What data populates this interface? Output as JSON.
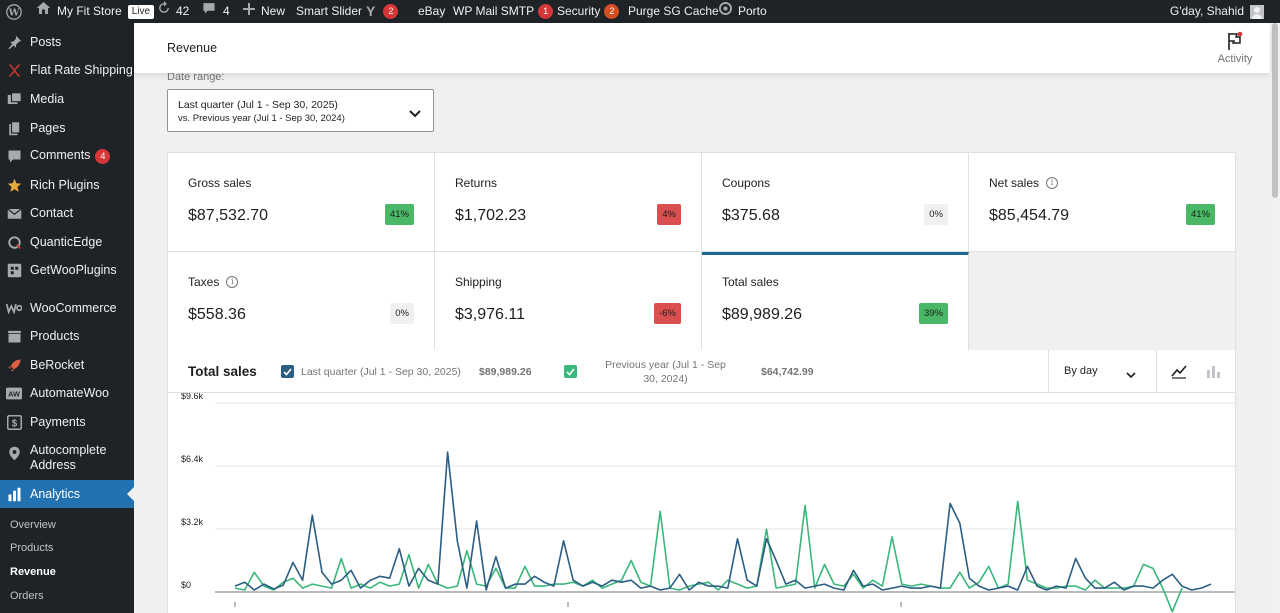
{
  "admin_bar": {
    "site_name": "My Fit Store",
    "live_badge": "Live",
    "updates_count": "42",
    "comments_count": "4",
    "new_label": "New",
    "smart_slider": "Smart Slider",
    "yoast_count": "2",
    "ebay": "eBay",
    "wp_mail_smtp": "WP Mail SMTP",
    "wp_mail_smtp_count": "1",
    "security": "Security",
    "security_count": "2",
    "purge_cache": "Purge SG Cache",
    "theme": "Porto",
    "greeting": "G'day, Shahid"
  },
  "sidebar": {
    "items": [
      {
        "label": "Posts",
        "icon": "pin-icon"
      },
      {
        "label": "Flat Rate Shipping",
        "icon": "shipping-icon"
      },
      {
        "label": "Media",
        "icon": "media-icon"
      },
      {
        "label": "Pages",
        "icon": "pages-icon"
      },
      {
        "label": "Comments",
        "icon": "comments-icon",
        "badge": "4"
      },
      {
        "label": "Rich Plugins",
        "icon": "star-icon"
      },
      {
        "label": "Contact",
        "icon": "mail-icon"
      },
      {
        "label": "QuanticEdge",
        "icon": "quanticedge-icon"
      },
      {
        "label": "GetWooPlugins",
        "icon": "grid-icon"
      },
      {
        "label": "WooCommerce",
        "icon": "woo-icon"
      },
      {
        "label": "Products",
        "icon": "box-icon"
      },
      {
        "label": "BeRocket",
        "icon": "rocket-icon"
      },
      {
        "label": "AutomateWoo",
        "icon": "aw-icon"
      },
      {
        "label": "Payments",
        "icon": "dollar-icon"
      },
      {
        "label": "Autocomplete Address",
        "icon": "location-icon"
      },
      {
        "label": "Analytics",
        "icon": "bar-chart-icon"
      }
    ],
    "sub_items": [
      "Overview",
      "Products",
      "Revenue",
      "Orders"
    ]
  },
  "header": {
    "title": "Revenue",
    "activity_label": "Activity"
  },
  "date_range": {
    "label": "Date range:",
    "main": "Last quarter (Jul 1 - Sep 30, 2025)",
    "compare": "vs. Previous year (Jul 1 - Sep 30, 2024)"
  },
  "summary": [
    {
      "label": "Gross sales",
      "value": "$87,532.70",
      "delta": "41%",
      "trend": "pos"
    },
    {
      "label": "Returns",
      "value": "$1,702.23",
      "delta": "4%",
      "trend": "neg"
    },
    {
      "label": "Coupons",
      "value": "$375.68",
      "delta": "0%",
      "trend": "zero"
    },
    {
      "label": "Net sales",
      "value": "$85,454.79",
      "delta": "41%",
      "trend": "pos",
      "info": true
    },
    {
      "label": "Taxes",
      "value": "$558.36",
      "delta": "0%",
      "trend": "zero",
      "info": true
    },
    {
      "label": "Shipping",
      "value": "$3,976.11",
      "delta": "-6%",
      "trend": "neg"
    },
    {
      "label": "Total sales",
      "value": "$89,989.26",
      "delta": "39%",
      "trend": "pos",
      "selected": true
    }
  ],
  "chart_panel": {
    "title": "Total sales",
    "legend": [
      {
        "label": "Last quarter (Jul 1 - Sep 30, 2025)",
        "total": "$89,989.26",
        "color": "#2c5e83"
      },
      {
        "label_line1": "Previous year (Jul 1 - Sep",
        "label_line2": "30, 2024)",
        "total": "$64,742.99",
        "color": "#3ab77a"
      }
    ],
    "interval": "By day"
  },
  "chart_data": {
    "type": "line",
    "y_ticks": [
      "$9.6k",
      "$6.4k",
      "$3.2k",
      "$0"
    ],
    "ylim": [
      -3200,
      9600
    ],
    "grid": true,
    "series": [
      {
        "name": "Last quarter (Jul 1 - Sep 30, 2025)",
        "color": "#2c5e83",
        "values": [
          300,
          500,
          100,
          400,
          150,
          350,
          1500,
          600,
          3900,
          1000,
          400,
          600,
          1100,
          200,
          600,
          800,
          700,
          2200,
          300,
          1200,
          600,
          400,
          7100,
          2600,
          200,
          3600,
          100,
          1800,
          200,
          400,
          400,
          800,
          500,
          300,
          2600,
          600,
          300,
          500,
          300,
          600,
          500,
          600,
          200,
          300,
          100,
          200,
          900,
          100,
          500,
          300,
          300,
          200,
          2700,
          600,
          300,
          2700,
          1600,
          400,
          600,
          200,
          300,
          400,
          200,
          100,
          1100,
          300,
          400,
          100,
          200,
          300,
          200,
          200,
          300,
          200,
          4500,
          3500,
          700,
          300,
          100,
          200,
          300,
          100,
          1300,
          300,
          100,
          300,
          200,
          1700,
          700,
          200,
          200,
          500,
          100,
          300,
          300,
          200,
          600,
          900,
          300,
          100,
          200,
          400
        ]
      },
      {
        "name": "Previous year (Jul 1 - Sep 30, 2024)",
        "color": "#3ab77a",
        "values": [
          200,
          100,
          1000,
          300,
          100,
          500,
          700,
          200,
          400,
          300,
          200,
          1700,
          200,
          400,
          200,
          500,
          300,
          400,
          1900,
          200,
          1400,
          400,
          200,
          300,
          2100,
          400,
          300,
          1200,
          200,
          200,
          1300,
          300,
          300,
          400,
          400,
          500,
          300,
          600,
          200,
          400,
          600,
          1600,
          500,
          300,
          4100,
          200,
          100,
          300,
          400,
          500,
          100,
          600,
          400,
          200,
          300,
          3200,
          200,
          300,
          400,
          4400,
          200,
          1400,
          400,
          300,
          900,
          200,
          600,
          300,
          2800,
          400,
          300,
          400,
          300,
          200,
          200,
          1000,
          200,
          500,
          1300,
          200,
          400,
          4600,
          600,
          400,
          200,
          200,
          300,
          300,
          100,
          600,
          200,
          200,
          200,
          300,
          1400,
          1200,
          200,
          -1000,
          200
        ]
      }
    ]
  }
}
